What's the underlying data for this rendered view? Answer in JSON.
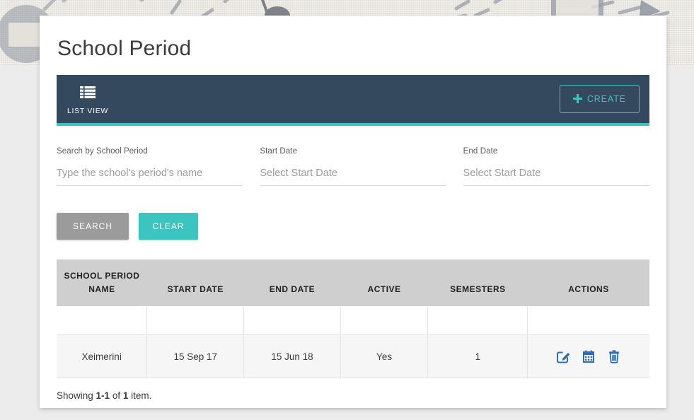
{
  "page": {
    "title": "School Period"
  },
  "tabbar": {
    "tabs": [
      {
        "label": "LIST VIEW",
        "icon": "list-icon",
        "active": true
      }
    ],
    "create_label": "CREATE",
    "create_icon": "plus-icon",
    "bg_color": "#34495e",
    "accent_color": "#3bc4c0"
  },
  "filters": {
    "fields": [
      {
        "label": "Search by School Period",
        "placeholder": "Type the school's period's name",
        "value": ""
      },
      {
        "label": "Start Date",
        "placeholder": "Select Start Date",
        "value": ""
      },
      {
        "label": "End Date",
        "placeholder": "Select Start Date",
        "value": ""
      }
    ],
    "search_label": "SEARCH",
    "clear_label": "CLEAR",
    "search_color": "#9b9b9b",
    "clear_color": "#3bc4c0"
  },
  "table": {
    "headers": [
      "SCHOOL PERIOD NAME",
      "START DATE",
      "END DATE",
      "ACTIVE",
      "SEMESTERS",
      "ACTIONS"
    ],
    "header_bg": "#cfcfcf",
    "rows": [
      {
        "name": "Xeimerini",
        "start_date": "15 Sep 17",
        "end_date": "15 Jun 18",
        "active": "Yes",
        "semesters": "1",
        "actions": [
          "edit-icon",
          "calendar-icon",
          "trash-icon"
        ]
      }
    ],
    "action_icon_color": "#2a6ebb"
  },
  "footer": {
    "showing_prefix": "Showing ",
    "range": "1-1",
    "of": " of ",
    "count": "1",
    "suffix": " item."
  }
}
